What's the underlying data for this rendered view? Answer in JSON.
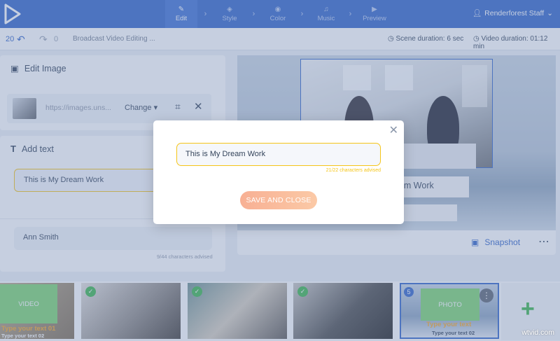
{
  "header": {
    "steps": [
      {
        "label": "Edit",
        "icon": "✎"
      },
      {
        "label": "Style",
        "icon": "◈"
      },
      {
        "label": "Color",
        "icon": "◉"
      },
      {
        "label": "Music",
        "icon": "♫"
      },
      {
        "label": "Preview",
        "icon": "▶"
      }
    ],
    "user_name": "Renderforest Staff",
    "user_icon": "person-icon",
    "brand_color": "#2f63c9"
  },
  "subbar": {
    "undo_count": "20",
    "redo_count": "0",
    "project_name": "Broadcast Video Editing ...",
    "scene_duration_label": "Scene duration:",
    "scene_duration_value": "6 sec",
    "video_duration_label": "Video duration:",
    "video_duration_value": "01:12 min"
  },
  "edit_image": {
    "title": "Edit Image",
    "url": "https://images.uns...",
    "change_label": "Change"
  },
  "add_text": {
    "title": "Add text",
    "field1_value": "This is My Dream Work",
    "field2_value": "Ann Smith",
    "field2_hint": "9/44 characters advised"
  },
  "preview": {
    "label1": "eam Work",
    "label2": "ith",
    "snapshot_label": "Snapshot"
  },
  "timeline": {
    "scene1_label": "VIDEO",
    "scene1_text1": "Type your text 01",
    "scene1_text2": "Type your text 02",
    "scene5_number": "5",
    "scene5_box": "PHOTO",
    "scene5_text1": "Type your text",
    "scene5_text2": "Type your text 02"
  },
  "modal": {
    "input_value": "This is My Dream Work",
    "hint": "21/22 characters advised",
    "save_label": "SAVE AND CLOSE",
    "accent_color": "#f5c518"
  },
  "watermark": "wtvid.com"
}
